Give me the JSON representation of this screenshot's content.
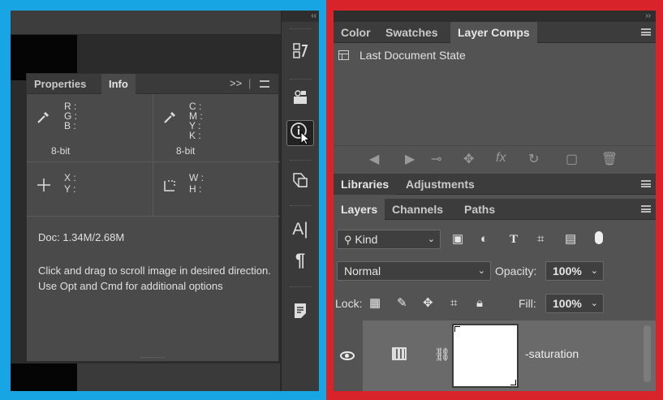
{
  "left_panel": {
    "tabs": [
      {
        "label": "Properties",
        "active": false
      },
      {
        "label": "Info",
        "active": true
      }
    ],
    "menu_glyph": ">>",
    "info": {
      "rgb_labels": [
        "R :",
        "G :",
        "B :"
      ],
      "cmyk_labels": [
        "C :",
        "M :",
        "Y :",
        "K :"
      ],
      "bit_left": "8-bit",
      "bit_right": "8-bit",
      "xy_labels": [
        "X :",
        "Y :"
      ],
      "wh_labels": [
        "W :",
        "H :"
      ],
      "doc_size": "Doc: 1.34M/2.68M",
      "hint": "Click and drag to scroll image in desired direction.  Use Opt and Cmd for additional options"
    }
  },
  "tool_strip": {
    "collapse_glyph": "‹‹",
    "tools": [
      {
        "name": "history-icon"
      },
      {
        "name": "3d-icon"
      },
      {
        "name": "info-icon",
        "selected": true
      },
      {
        "name": "transform-icon"
      },
      {
        "name": "character-icon",
        "glyph": "A|"
      },
      {
        "name": "paragraph-icon",
        "glyph": "¶"
      },
      {
        "name": "notes-icon"
      }
    ]
  },
  "right_panel": {
    "collapse_glyph": "››",
    "top_tabs": [
      {
        "label": "Color",
        "active": false
      },
      {
        "label": "Swatches",
        "active": false
      },
      {
        "label": "Layer Comps",
        "active": true
      }
    ],
    "layer_comps": [
      {
        "label": "Last Document State"
      }
    ],
    "mid_tabs": [
      {
        "label": "Libraries",
        "active": true
      },
      {
        "label": "Adjustments",
        "active": false
      }
    ],
    "layer_tabs": [
      {
        "label": "Layers",
        "active": true
      },
      {
        "label": "Channels",
        "active": false
      },
      {
        "label": "Paths",
        "active": false
      }
    ],
    "filter": {
      "label": "Kind"
    },
    "blend_mode": "Normal",
    "opacity_label": "Opacity:",
    "opacity_value": "100%",
    "lock_label": "Lock:",
    "fill_label": "Fill:",
    "fill_value": "100%",
    "layer": {
      "name": "-saturation"
    }
  },
  "colors": {
    "left_frame": "#17a6e3",
    "right_frame": "#d9232b"
  }
}
